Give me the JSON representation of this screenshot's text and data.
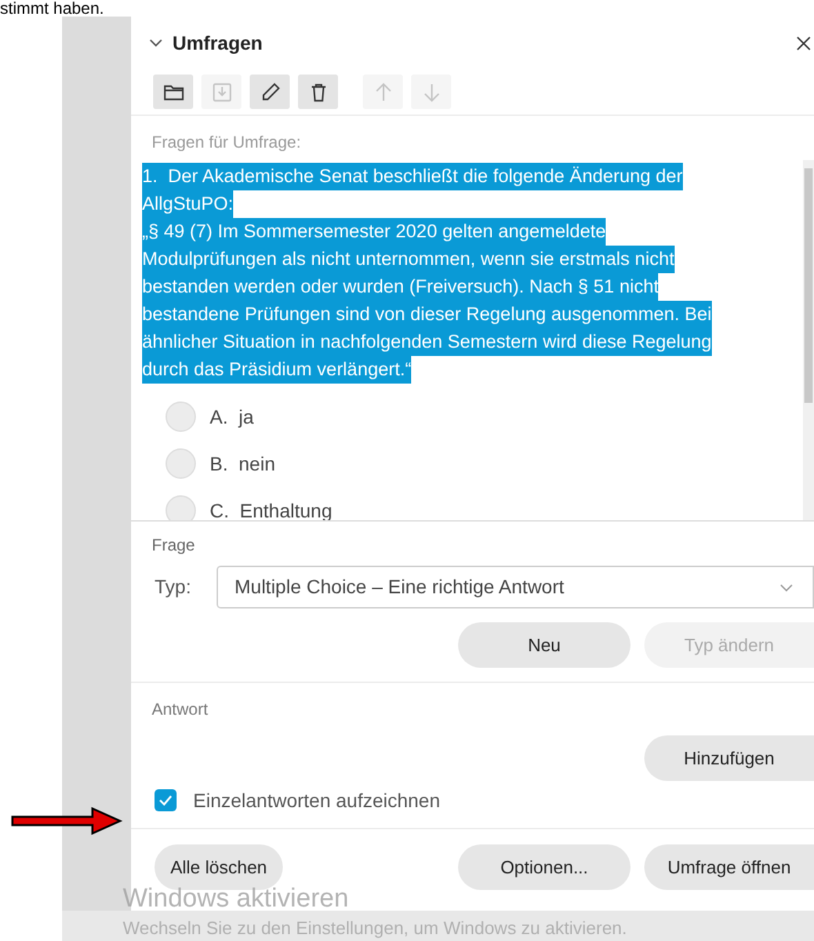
{
  "document_text": "stimmt haben.",
  "panel": {
    "title": "Umfragen",
    "expanded": true
  },
  "toolbar": [
    {
      "kind": "folder",
      "disabled": false
    },
    {
      "kind": "save",
      "disabled": true
    },
    {
      "kind": "edit",
      "disabled": false
    },
    {
      "kind": "delete",
      "disabled": false
    },
    {
      "kind": "up",
      "disabled": true
    },
    {
      "kind": "down",
      "disabled": true
    }
  ],
  "questions_label": "Fragen für Umfrage:",
  "question": {
    "selected": true,
    "lines": [
      "1.  Der Akademische Senat beschließt die folgende Änderung der",
      "AllgStuPO:",
      "„§ 49 (7) Im Sommersemester 2020 gelten angemeldete",
      "Modulprüfungen als nicht unternommen, wenn sie erstmals nicht",
      "bestanden werden oder wurden (Freiversuch). Nach § 51 nicht",
      "bestandene Prüfungen sind von dieser Regelung ausgenommen. Bei",
      "ähnlicher Situation in nachfolgenden Semestern wird diese Regelung",
      "durch das Präsidium verlängert.“"
    ]
  },
  "options": [
    {
      "letter": "A.",
      "text": "ja",
      "selected": false
    },
    {
      "letter": "B.",
      "text": "nein",
      "selected": false
    },
    {
      "letter": "C.",
      "text": "Enthaltung",
      "selected": false
    }
  ],
  "frage": {
    "heading": "Frage",
    "type_label": "Typ:",
    "type_value": "Multiple Choice – Eine richtige Antwort",
    "buttons": [
      {
        "label": "Neu",
        "disabled": false
      },
      {
        "label": "Typ ändern",
        "disabled": true
      }
    ]
  },
  "antwort": {
    "heading": "Antwort",
    "add_button": "Hinzufügen",
    "record_checkbox": {
      "label": "Einzelantworten aufzeichnen",
      "checked": true
    }
  },
  "footer_buttons": [
    {
      "label": "Alle löschen"
    },
    {
      "label": "Optionen..."
    },
    {
      "label": "Umfrage öffnen"
    }
  ],
  "activation": {
    "title": "Windows aktivieren",
    "text": "Wechseln Sie zu den Einstellungen, um Windows zu aktivieren."
  }
}
